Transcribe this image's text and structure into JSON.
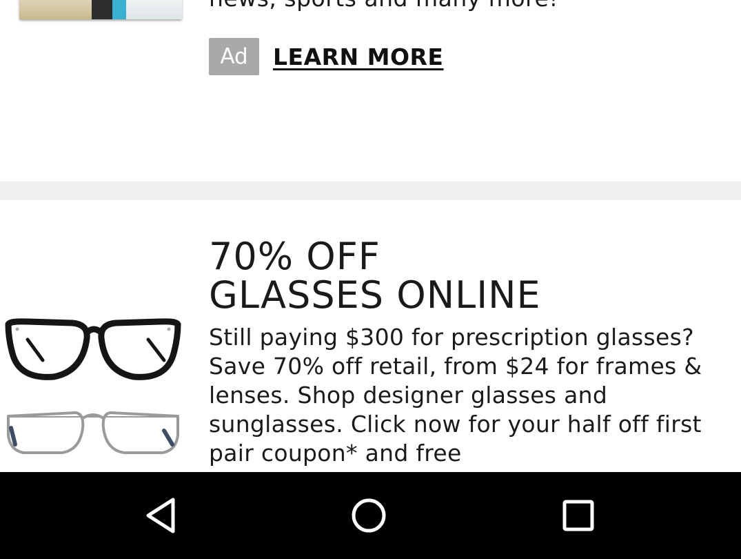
{
  "ad1": {
    "body_text": "news, sports and many more!",
    "ad_badge": "Ad",
    "cta": "LEARN MORE"
  },
  "ad2": {
    "title_line1": "70% OFF",
    "title_line2": "GLASSES ONLINE",
    "description": "Still paying $300 for prescription glasses? Save 70% off retail, from $24 for frames & lenses. Shop designer glasses and sunglasses. Click now for your half off first pair coupon* and free",
    "image_icon": "eyeglasses-icon"
  },
  "navbar": {
    "back_icon": "back-triangle-icon",
    "home_icon": "home-circle-icon",
    "recents_icon": "recents-square-icon"
  },
  "colors": {
    "divider": "#efefed",
    "ad_badge_bg": "#a9a9a9",
    "navbar_bg": "#000000",
    "text": "#1a1a1a"
  }
}
